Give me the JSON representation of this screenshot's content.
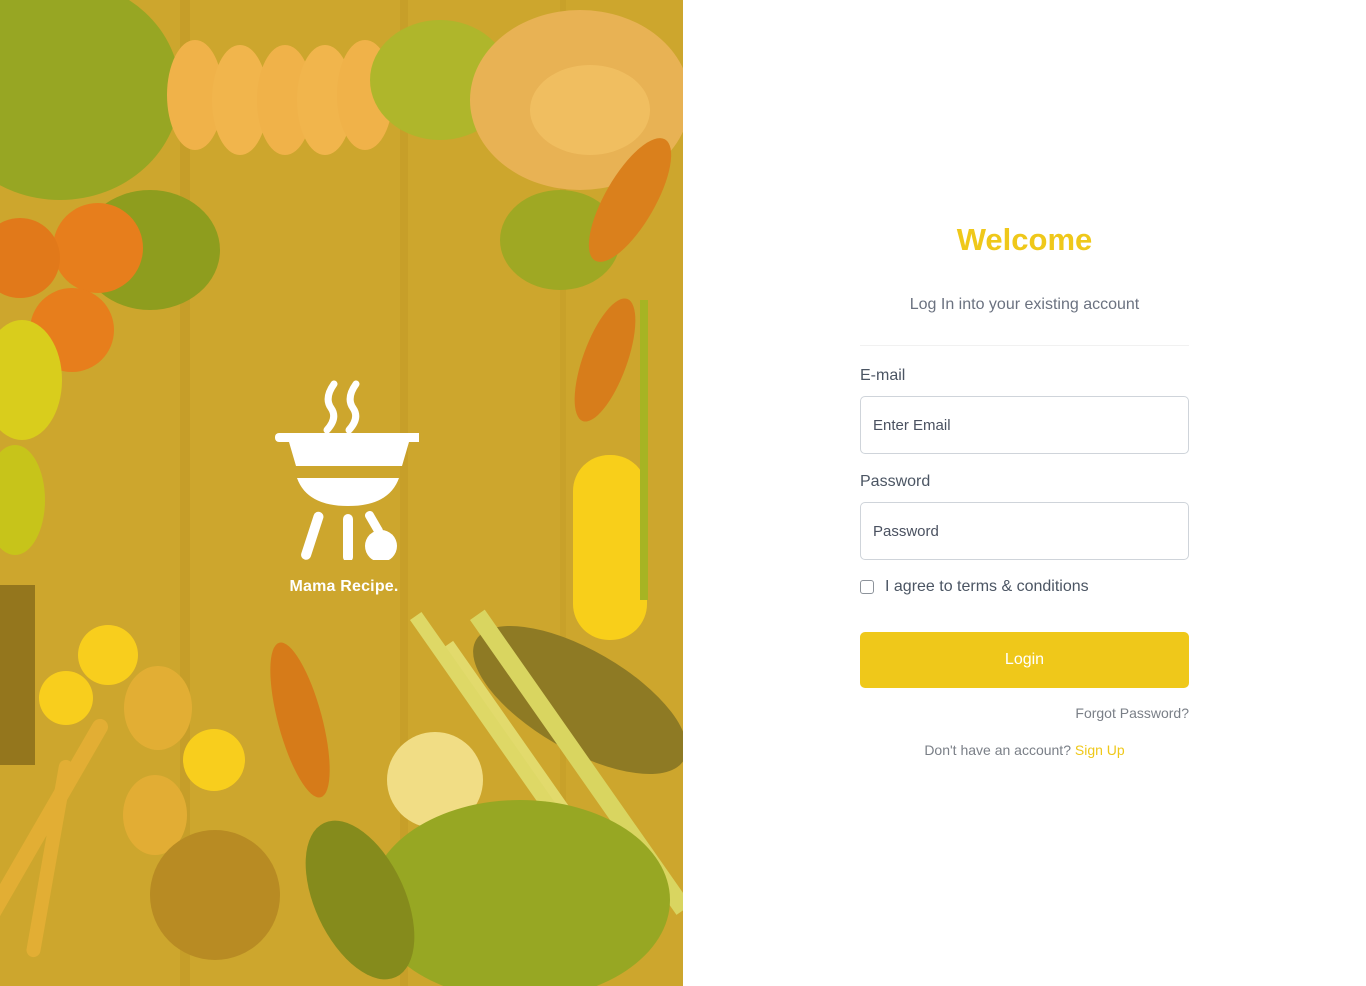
{
  "brand": {
    "name": "Mama Recipe.",
    "logo_icon": "barbecue-grill-icon"
  },
  "form": {
    "title": "Welcome",
    "subtitle": "Log In into your existing account",
    "email_label": "E-mail",
    "email_placeholder": "Enter Email",
    "email_value": "",
    "password_label": "Password",
    "password_placeholder": "Password",
    "password_value": "",
    "terms_label": "I agree to terms & conditions",
    "terms_checked": false,
    "login_label": "Login",
    "forgot_label": "Forgot Password?",
    "signup_prompt": "Don't have an account?",
    "signup_link": "Sign Up"
  },
  "colors": {
    "accent": "#efc81a",
    "text_muted": "#6b7280"
  }
}
